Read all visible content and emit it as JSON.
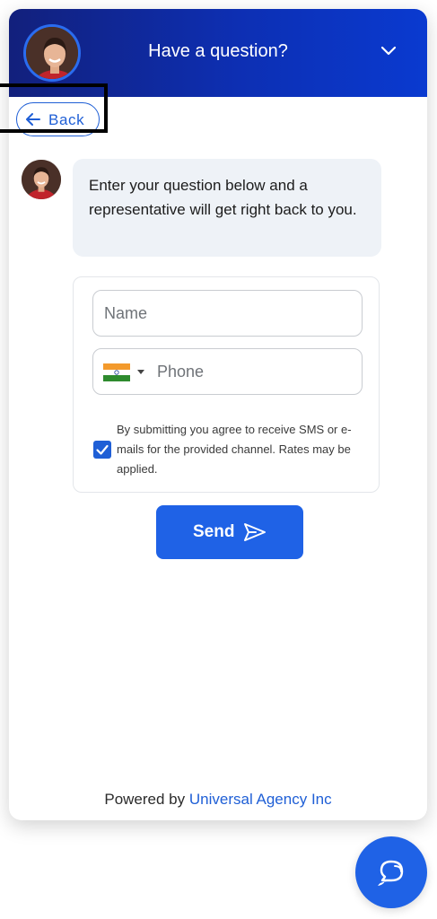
{
  "header": {
    "title": "Have a question?",
    "avatar_icon": "agent-avatar",
    "collapse_icon": "chevron-down-icon"
  },
  "nav": {
    "back_label": "Back"
  },
  "message": {
    "text": "Enter your question below and a representative will get right back to you."
  },
  "form": {
    "name_placeholder": "Name",
    "name_value": "",
    "phone_placeholder": "Phone",
    "phone_value": "",
    "country_flag": "india-flag",
    "consent_checked": true,
    "consent_text": "By submitting you agree to receive SMS or e-mails for the provided channel. Rates may be applied.",
    "send_label": "Send"
  },
  "footer": {
    "powered_prefix": "Powered by",
    "brand": "Universal Agency Inc"
  },
  "colors": {
    "accent": "#1f62e6",
    "header_start": "#12207c",
    "header_end": "#0a3ad0",
    "bubble": "#eef2f7"
  }
}
